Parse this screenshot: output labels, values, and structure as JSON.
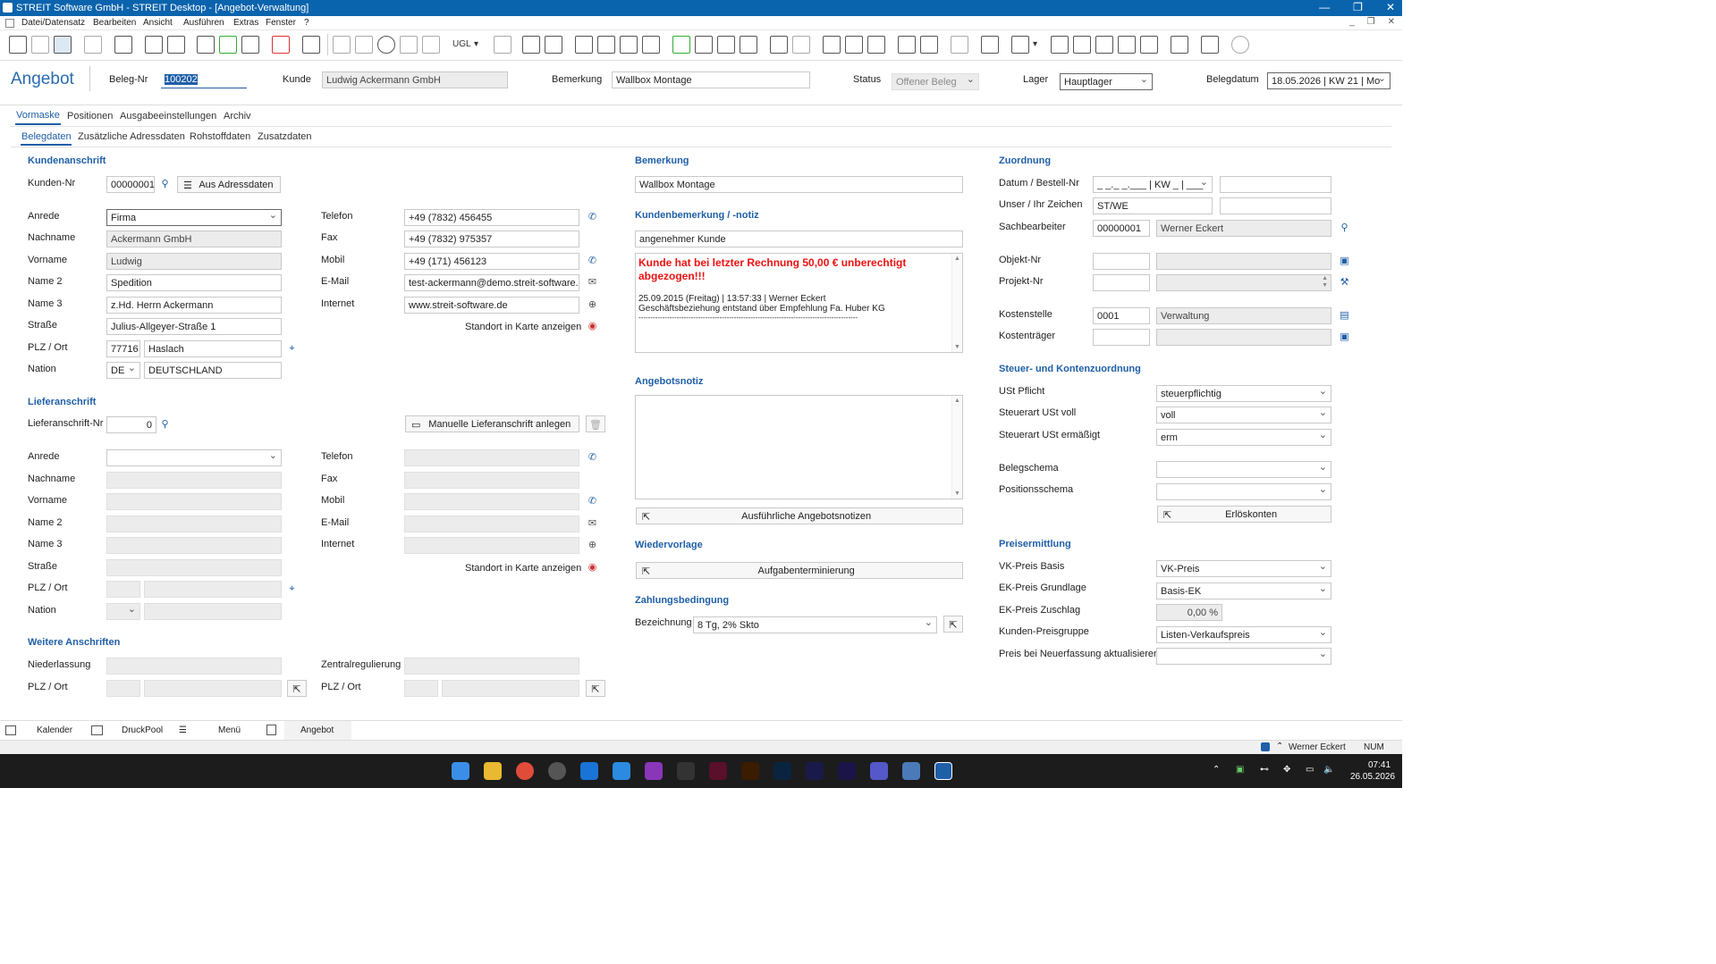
{
  "window": {
    "title": "STREIT Software GmbH - STREIT Desktop - [Angebot-Verwaltung]",
    "controls": [
      "—",
      "❐",
      "✕"
    ]
  },
  "menu": [
    "Datei/Datensatz",
    "Bearbeiten",
    "Ansicht",
    "Ausführen",
    "Extras",
    "Fenster",
    "?"
  ],
  "menu_mdi": [
    "_",
    "❐",
    "✕"
  ],
  "toolbar": {
    "ugl_label": "UGL"
  },
  "header": {
    "title": "Angebot",
    "beleg_label": "Beleg-Nr",
    "beleg_value": "100202",
    "kunde_label": "Kunde",
    "kunde_value": "Ludwig Ackermann GmbH",
    "bemerkung_label": "Bemerkung",
    "bemerkung_value": "Wallbox Montage",
    "status_label": "Status",
    "status_value": "Offener Beleg",
    "lager_label": "Lager",
    "lager_value": "Hauptlager",
    "belegdatum_label": "Belegdatum",
    "belegdatum_value": "18.05.2026 | KW 21 | Mo"
  },
  "tabs": [
    "Vormaske",
    "Positionen",
    "Ausgabeeinstellungen",
    "Archiv"
  ],
  "subtabs": [
    "Belegdaten",
    "Zusätzliche Adressdaten",
    "Rohstoffdaten",
    "Zusatzdaten"
  ],
  "kunden": {
    "section": "Kundenanschrift",
    "kundennr_label": "Kunden-Nr",
    "kundennr_value": "00000001",
    "aus_adress_btn": "Aus Adressdaten",
    "anrede_label": "Anrede",
    "anrede_value": "Firma",
    "nachname_label": "Nachname",
    "nachname_value": "Ackermann GmbH",
    "vorname_label": "Vorname",
    "vorname_value": "Ludwig",
    "name2_label": "Name 2",
    "name2_value": "Spedition",
    "name3_label": "Name 3",
    "name3_value": "z.Hd. Herrn Ackermann",
    "strasse_label": "Straße",
    "strasse_value": "Julius-Allgeyer-Straße 1",
    "plz_label": "PLZ / Ort",
    "plz_value": "77716",
    "ort_value": "Haslach",
    "nation_label": "Nation",
    "nation_code": "DE",
    "nation_value": "DEUTSCHLAND",
    "telefon_label": "Telefon",
    "telefon_value": "+49 (7832) 456455",
    "fax_label": "Fax",
    "fax_value": "+49 (7832) 975357",
    "mobil_label": "Mobil",
    "mobil_value": "+49 (171) 456123",
    "email_label": "E-Mail",
    "email_value": "test-ackermann@demo.streit-software.d",
    "internet_label": "Internet",
    "internet_value": "www.streit-software.de",
    "karte_label": "Standort in Karte anzeigen"
  },
  "liefer": {
    "section": "Lieferanschrift",
    "nr_label": "Lieferanschrift-Nr",
    "nr_value": "0",
    "manuell_btn": "Manuelle Lieferanschrift anlegen",
    "anrede_label": "Anrede",
    "nachname_label": "Nachname",
    "vorname_label": "Vorname",
    "name2_label": "Name 2",
    "name3_label": "Name 3",
    "strasse_label": "Straße",
    "plz_label": "PLZ / Ort",
    "nation_label": "Nation",
    "telefon_label": "Telefon",
    "fax_label": "Fax",
    "mobil_label": "Mobil",
    "email_label": "E-Mail",
    "internet_label": "Internet",
    "karte_label": "Standort in Karte anzeigen"
  },
  "weitere": {
    "section": "Weitere Anschriften",
    "niederlassung_label": "Niederlassung",
    "plz_label": "PLZ / Ort",
    "zentral_label": "Zentralregulierung",
    "plz2_label": "PLZ / Ort"
  },
  "mid": {
    "bemerkung_section": "Bemerkung",
    "bemerkung_value": "Wallbox Montage",
    "kundenbem_section": "Kundenbemerkung / -notiz",
    "kundenbem_value": "angenehmer Kunde",
    "notiz_red": "Kunde hat bei letzter Rechnung 50,00 € unberechtigt abgezogen!!!",
    "notiz_line1": "25.09.2015 (Freitag) | 13:57:33 | Werner Eckert",
    "notiz_line2": "Geschäftsbeziehung entstand über Empfehlung Fa. Huber KG",
    "notiz_line3": "--------------------------------------------------------------------------------------------",
    "angebotsnotiz_section": "Angebotsnotiz",
    "ausf_btn": "Ausführliche Angebotsnotizen",
    "wieder_section": "Wiedervorlage",
    "aufgaben_btn": "Aufgabenterminierung",
    "zahlung_section": "Zahlungsbedingung",
    "bezeichnung_label": "Bezeichnung",
    "bezeichnung_value": "8 Tg, 2% Skto"
  },
  "right": {
    "zuordnung_section": "Zuordnung",
    "datum_label": "Datum / Bestell-Nr",
    "datum_value": "_ _._ _.___ | KW _ | ___",
    "unser_label": "Unser / Ihr Zeichen",
    "unser_value": "ST/WE",
    "sach_label": "Sachbearbeiter",
    "sach_nr": "00000001",
    "sach_name": "Werner Eckert",
    "objekt_label": "Objekt-Nr",
    "projekt_label": "Projekt-Nr",
    "kostenstelle_label": "Kostenstelle",
    "kostenstelle_nr": "0001",
    "kostenstelle_name": "Verwaltung",
    "kostentraeger_label": "Kostenträger",
    "steuer_section": "Steuer- und Kontenzuordnung",
    "ust_label": "USt Pflicht",
    "ust_value": "steuerpflichtig",
    "voll_label": "Steuerart USt voll",
    "voll_value": "voll",
    "erm_label": "Steuerart USt ermäßigt",
    "erm_value": "erm",
    "belegschema_label": "Belegschema",
    "positionsschema_label": "Positionsschema",
    "erloes_btn": "Erlöskonten",
    "preis_section": "Preisermittlung",
    "vk_label": "VK-Preis Basis",
    "vk_value": "VK-Preis",
    "ek_label": "EK-Preis Grundlage",
    "ek_value": "Basis-EK",
    "zuschlag_label": "EK-Preis Zuschlag",
    "zuschlag_value": "0,00 %",
    "kpg_label": "Kunden-Preisgruppe",
    "kpg_value": "Listen-Verkaufspreis",
    "neuf_label": "Preis bei Neuerfassung aktualisieren"
  },
  "bottom": [
    "Kalender",
    "DruckPool",
    "Menü",
    "Angebot"
  ],
  "status": {
    "user": "Werner Eckert",
    "num": "NUM"
  },
  "clock": {
    "time": "07:41",
    "date": "26.05.2026"
  },
  "icons": {
    "phone": "phone-icon",
    "mail": "mail-icon",
    "globe": "globe-icon",
    "map": "map-pin-icon",
    "person": "person-search-icon"
  }
}
